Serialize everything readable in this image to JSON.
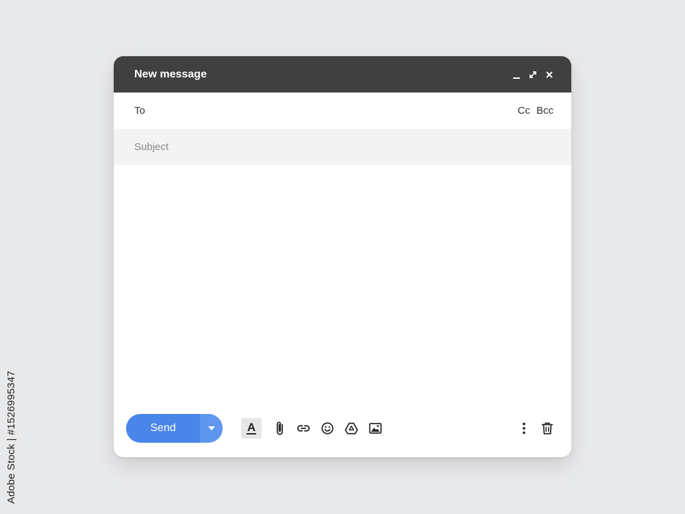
{
  "stock_credit": "Adobe Stock | #1526995347",
  "compose": {
    "title": "New message",
    "window_controls": [
      "minimize-icon",
      "expand-icon",
      "close-icon"
    ],
    "to_label": "To",
    "cc_label": "Cc",
    "bcc_label": "Bcc",
    "subject_placeholder": "Subject",
    "send_label": "Send",
    "toolbar_icons": [
      "text-format-icon",
      "paperclip-icon",
      "link-icon",
      "emoji-icon",
      "drive-icon",
      "image-icon"
    ],
    "right_icons": [
      "more-vertical-icon",
      "trash-icon"
    ]
  },
  "colors": {
    "page_bg": "#e8e9eb",
    "titlebar_bg": "#404040",
    "send_button": "#4a86e8",
    "send_dropdown": "#5f96ee",
    "subject_bg": "#f3f3f3"
  }
}
